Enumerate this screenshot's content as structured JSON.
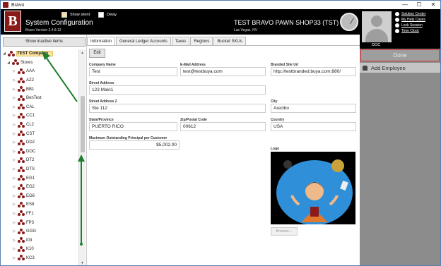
{
  "window": {
    "title": "Bravo",
    "controls": [
      "—",
      "☐",
      "✕"
    ]
  },
  "header": {
    "logo_letter": "B",
    "title": "System Configuration",
    "version": "Bravo Version 2.4.8.13",
    "show_silent_label": "Show silent",
    "delay_label": "Delay",
    "store_name": "TEST BRAVO PAWN SHOP33 (TST)",
    "store_location": "Las Vegas, NV"
  },
  "user": {
    "name": "DOC",
    "links": [
      "Solution Center",
      "My Help Cases",
      "Lock Session",
      "Time Clock"
    ],
    "done_label": "Done",
    "add_employee_label": "Add Employee"
  },
  "sidebar": {
    "show_inactive_label": "Show inactive items",
    "company": "TEST Company",
    "stores_label": "Stores",
    "stores": [
      "AAA",
      "AZ2",
      "BB1",
      "BenTest",
      "CAL",
      "CC1",
      "CL2",
      "CST",
      "DD2",
      "DOC",
      "DT2",
      "DTS",
      "EG1",
      "EG2",
      "EG6",
      "ES8",
      "FF1",
      "FP3",
      "GGG",
      "I03",
      "K10",
      "KC3"
    ]
  },
  "tabs": [
    "Information",
    "General Ledger Accounts",
    "Taxes",
    "Regions",
    "Bucket SKUs"
  ],
  "form": {
    "edit_label": "Edit",
    "company_name_label": "Company Name",
    "company_name": "Test",
    "email_label": "E-Mail Address",
    "email": "test@testbuya.com",
    "branded_url_label": "Branded Site Url",
    "branded_url": "http://testbranded.buya.com:880/",
    "street1_label": "Street Address",
    "street1": "123 Main1",
    "street2_label": "Street Address 2",
    "street2": "Ste 112",
    "city_label": "City",
    "city": "Arecibo",
    "state_label": "State/Province",
    "state": "PUERTO RICO",
    "zip_label": "Zip/Postal Code",
    "zip": "00612",
    "country_label": "Country",
    "country": "USA",
    "max_principal_label": "Maximum Outstanding Principal per Customer",
    "max_principal": "$5,002.00",
    "logo_label": "Logo",
    "browse_label": "Browse..."
  }
}
